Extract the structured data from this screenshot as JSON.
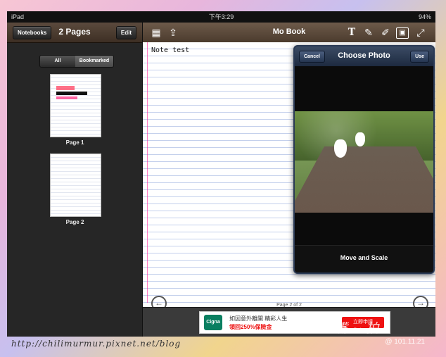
{
  "statusbar": {
    "device": "iPad",
    "time": "下午3:29",
    "battery": "94%"
  },
  "sidebar": {
    "notebooks_label": "Notebooks",
    "title": "2 Pages",
    "edit_label": "Edit",
    "filter": {
      "all_label": "All",
      "bookmarked_label": "Bookmarked"
    },
    "pages": [
      {
        "label": "Page 1"
      },
      {
        "label": "Page 2"
      }
    ]
  },
  "notepad": {
    "title": "Mo Book",
    "note_title": "Note test",
    "page_indicator": "Page 2 of 2"
  },
  "popover": {
    "title": "Choose Photo",
    "cancel_label": "Cancel",
    "use_label": "Use",
    "footer_label": "Move and Scale"
  },
  "ad": {
    "brand": "Cigna",
    "line1": "如因意外離開 精彩人生",
    "line2": "領回250%保險金",
    "button": "立即申請"
  },
  "watermark": {
    "url": "http://chilimurmur.pixnet.net/blog",
    "date": "@ 101.11.21"
  }
}
